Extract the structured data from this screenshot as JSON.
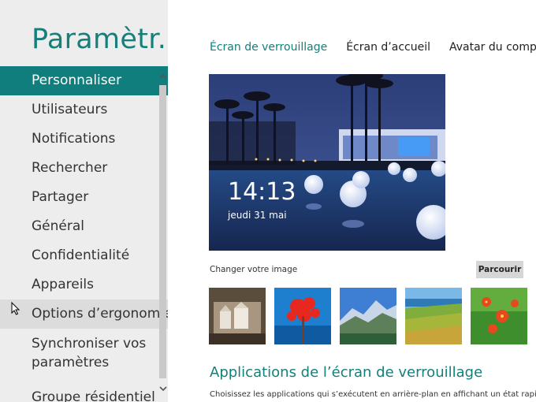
{
  "page": {
    "title": "Paramètr..."
  },
  "nav": {
    "items": [
      {
        "label": "Personnaliser"
      },
      {
        "label": "Utilisateurs"
      },
      {
        "label": "Notifications"
      },
      {
        "label": "Rechercher"
      },
      {
        "label": "Partager"
      },
      {
        "label": "Général"
      },
      {
        "label": "Confidentialité"
      },
      {
        "label": "Appareils"
      },
      {
        "label": "Options d’ergonomie"
      },
      {
        "label": "Synchroniser vos paramètres"
      },
      {
        "label": "Groupe résidentiel"
      }
    ]
  },
  "tabs": [
    {
      "label": "Écran de verrouillage"
    },
    {
      "label": "Écran d’accueil"
    },
    {
      "label": "Avatar du compte"
    }
  ],
  "preview": {
    "time": "14:13",
    "date": "jeudi 31 mai"
  },
  "image_section": {
    "change_label": "Changer votre image",
    "browse_label": "Parcourir"
  },
  "apps_section": {
    "title": "Applications de l’écran de verrouillage",
    "description": "Choisissez les applications qui s’exécutent en arrière-plan en affichant un état rapide et"
  },
  "colors": {
    "accent": "#0f7e7c",
    "pane_background": "#ededed"
  }
}
